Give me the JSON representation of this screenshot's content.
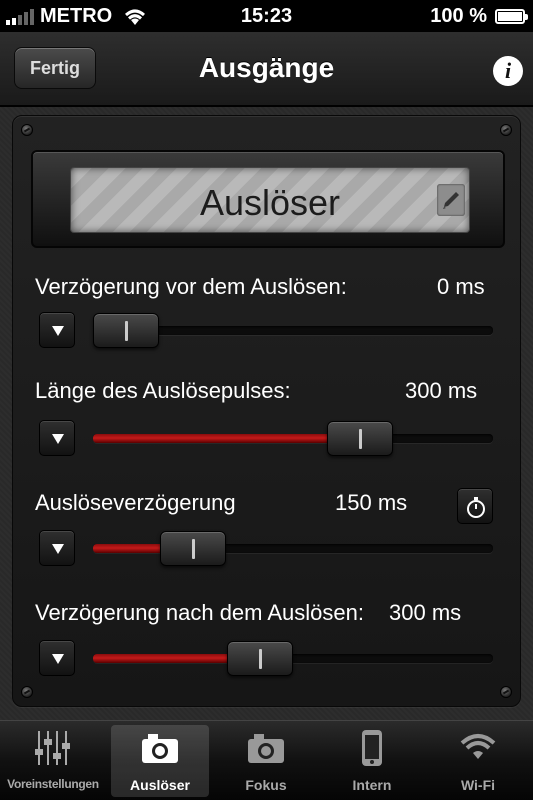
{
  "status_bar": {
    "carrier": "METRO",
    "time": "15:23",
    "battery_text": "100 %"
  },
  "nav": {
    "done_label": "Fertig",
    "title": "Ausgänge",
    "info_glyph": "i"
  },
  "label_display": {
    "text": "Auslöser",
    "edit_icon": "pencil-icon"
  },
  "rows": [
    {
      "label": "Verzögerung vor dem Auslösen:",
      "value": "0 ms",
      "slider_fraction": 0.0
    },
    {
      "label": "Länge des Auslösepulses:",
      "value": "300 ms",
      "slider_fraction": 0.7
    },
    {
      "label": "Auslöseverzögerung",
      "value": "150 ms",
      "slider_fraction": 0.2
    },
    {
      "label": "Verzögerung nach dem Auslösen:",
      "value": "300 ms",
      "slider_fraction": 0.4
    }
  ],
  "tabs": [
    {
      "label": "Voreinstellungen",
      "icon": "sliders-icon",
      "active": false
    },
    {
      "label": "Auslöser",
      "icon": "camera-icon",
      "active": true
    },
    {
      "label": "Fokus",
      "icon": "camera-icon",
      "active": false
    },
    {
      "label": "Intern",
      "icon": "phone-icon",
      "active": false
    },
    {
      "label": "Wi-Fi",
      "icon": "wifi-icon",
      "active": false
    }
  ],
  "colors": {
    "slider_fill": "#c41a1a",
    "label_screen": "#b3b3b3"
  }
}
